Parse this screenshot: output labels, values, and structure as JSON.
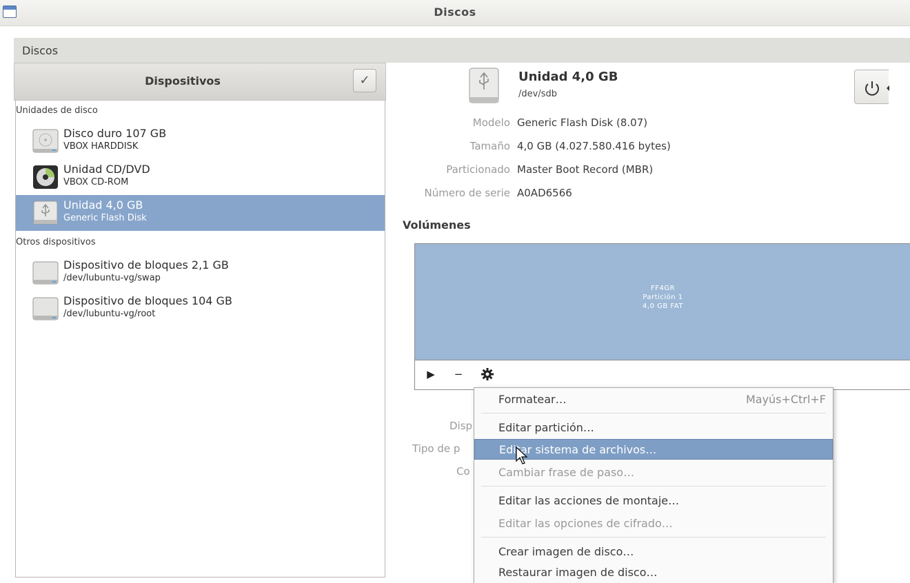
{
  "window": {
    "title": "Discos"
  },
  "appbar": {
    "title": "Discos"
  },
  "devices_panel": {
    "title": "Dispositivos",
    "sections": [
      {
        "label": "Unidades de disco"
      },
      {
        "label": "Otros dispositivos"
      }
    ],
    "items": [
      {
        "name": "Disco duro 107 GB",
        "sub": "VBOX HARDDISK",
        "icon": "hard-disk-icon",
        "selected": false
      },
      {
        "name": "Unidad CD/DVD",
        "sub": "VBOX CD-ROM",
        "icon": "optical-disc-icon",
        "selected": false
      },
      {
        "name": "Unidad 4,0 GB",
        "sub": "Generic Flash Disk",
        "icon": "usb-drive-icon",
        "selected": true
      },
      {
        "name": "Dispositivo de bloques 2,1 GB",
        "sub": "/dev/lubuntu-vg/swap",
        "icon": "block-device-icon",
        "selected": false
      },
      {
        "name": "Dispositivo de bloques 104 GB",
        "sub": "/dev/lubuntu-vg/root",
        "icon": "block-device-icon",
        "selected": false
      }
    ]
  },
  "drive": {
    "title": "Unidad 4,0 GB",
    "path": "/dev/sdb",
    "props": [
      {
        "label": "Modelo",
        "value": "Generic Flash Disk (8.07)"
      },
      {
        "label": "Tamaño",
        "value": "4,0 GB (4.027.580.416 bytes)"
      },
      {
        "label": "Particionado",
        "value": "Master Boot Record (MBR)"
      },
      {
        "label": "Número de serie",
        "value": "A0AD6566"
      }
    ]
  },
  "volumes": {
    "title": "Volúmenes",
    "partition": {
      "line1": "FF4GR",
      "line2": "Partición 1",
      "line3": "4,0 GB FAT"
    },
    "partial_labels": [
      "Disp",
      "Tipo de p",
      "Co"
    ]
  },
  "context_menu": {
    "items": [
      {
        "label": "Formatear…",
        "accel": "Mayús+Ctrl+F",
        "state": "normal"
      },
      {
        "label": "Editar partición…",
        "accel": "",
        "state": "normal"
      },
      {
        "label": "Editar sistema de archivos…",
        "accel": "",
        "state": "highlighted"
      },
      {
        "label": "Cambiar frase de paso…",
        "accel": "",
        "state": "disabled"
      },
      {
        "label": "Editar las acciones de montaje…",
        "accel": "",
        "state": "normal"
      },
      {
        "label": "Editar las opciones de cifrado…",
        "accel": "",
        "state": "disabled"
      },
      {
        "label": "Crear imagen de disco…",
        "accel": "",
        "state": "normal"
      },
      {
        "label": "Restaurar imagen de disco…",
        "accel": "",
        "state": "normal"
      }
    ]
  },
  "colors": {
    "selection": "#87a5cb",
    "partition": "#9db8d6",
    "menu_highlight": "#7f9ec5"
  }
}
